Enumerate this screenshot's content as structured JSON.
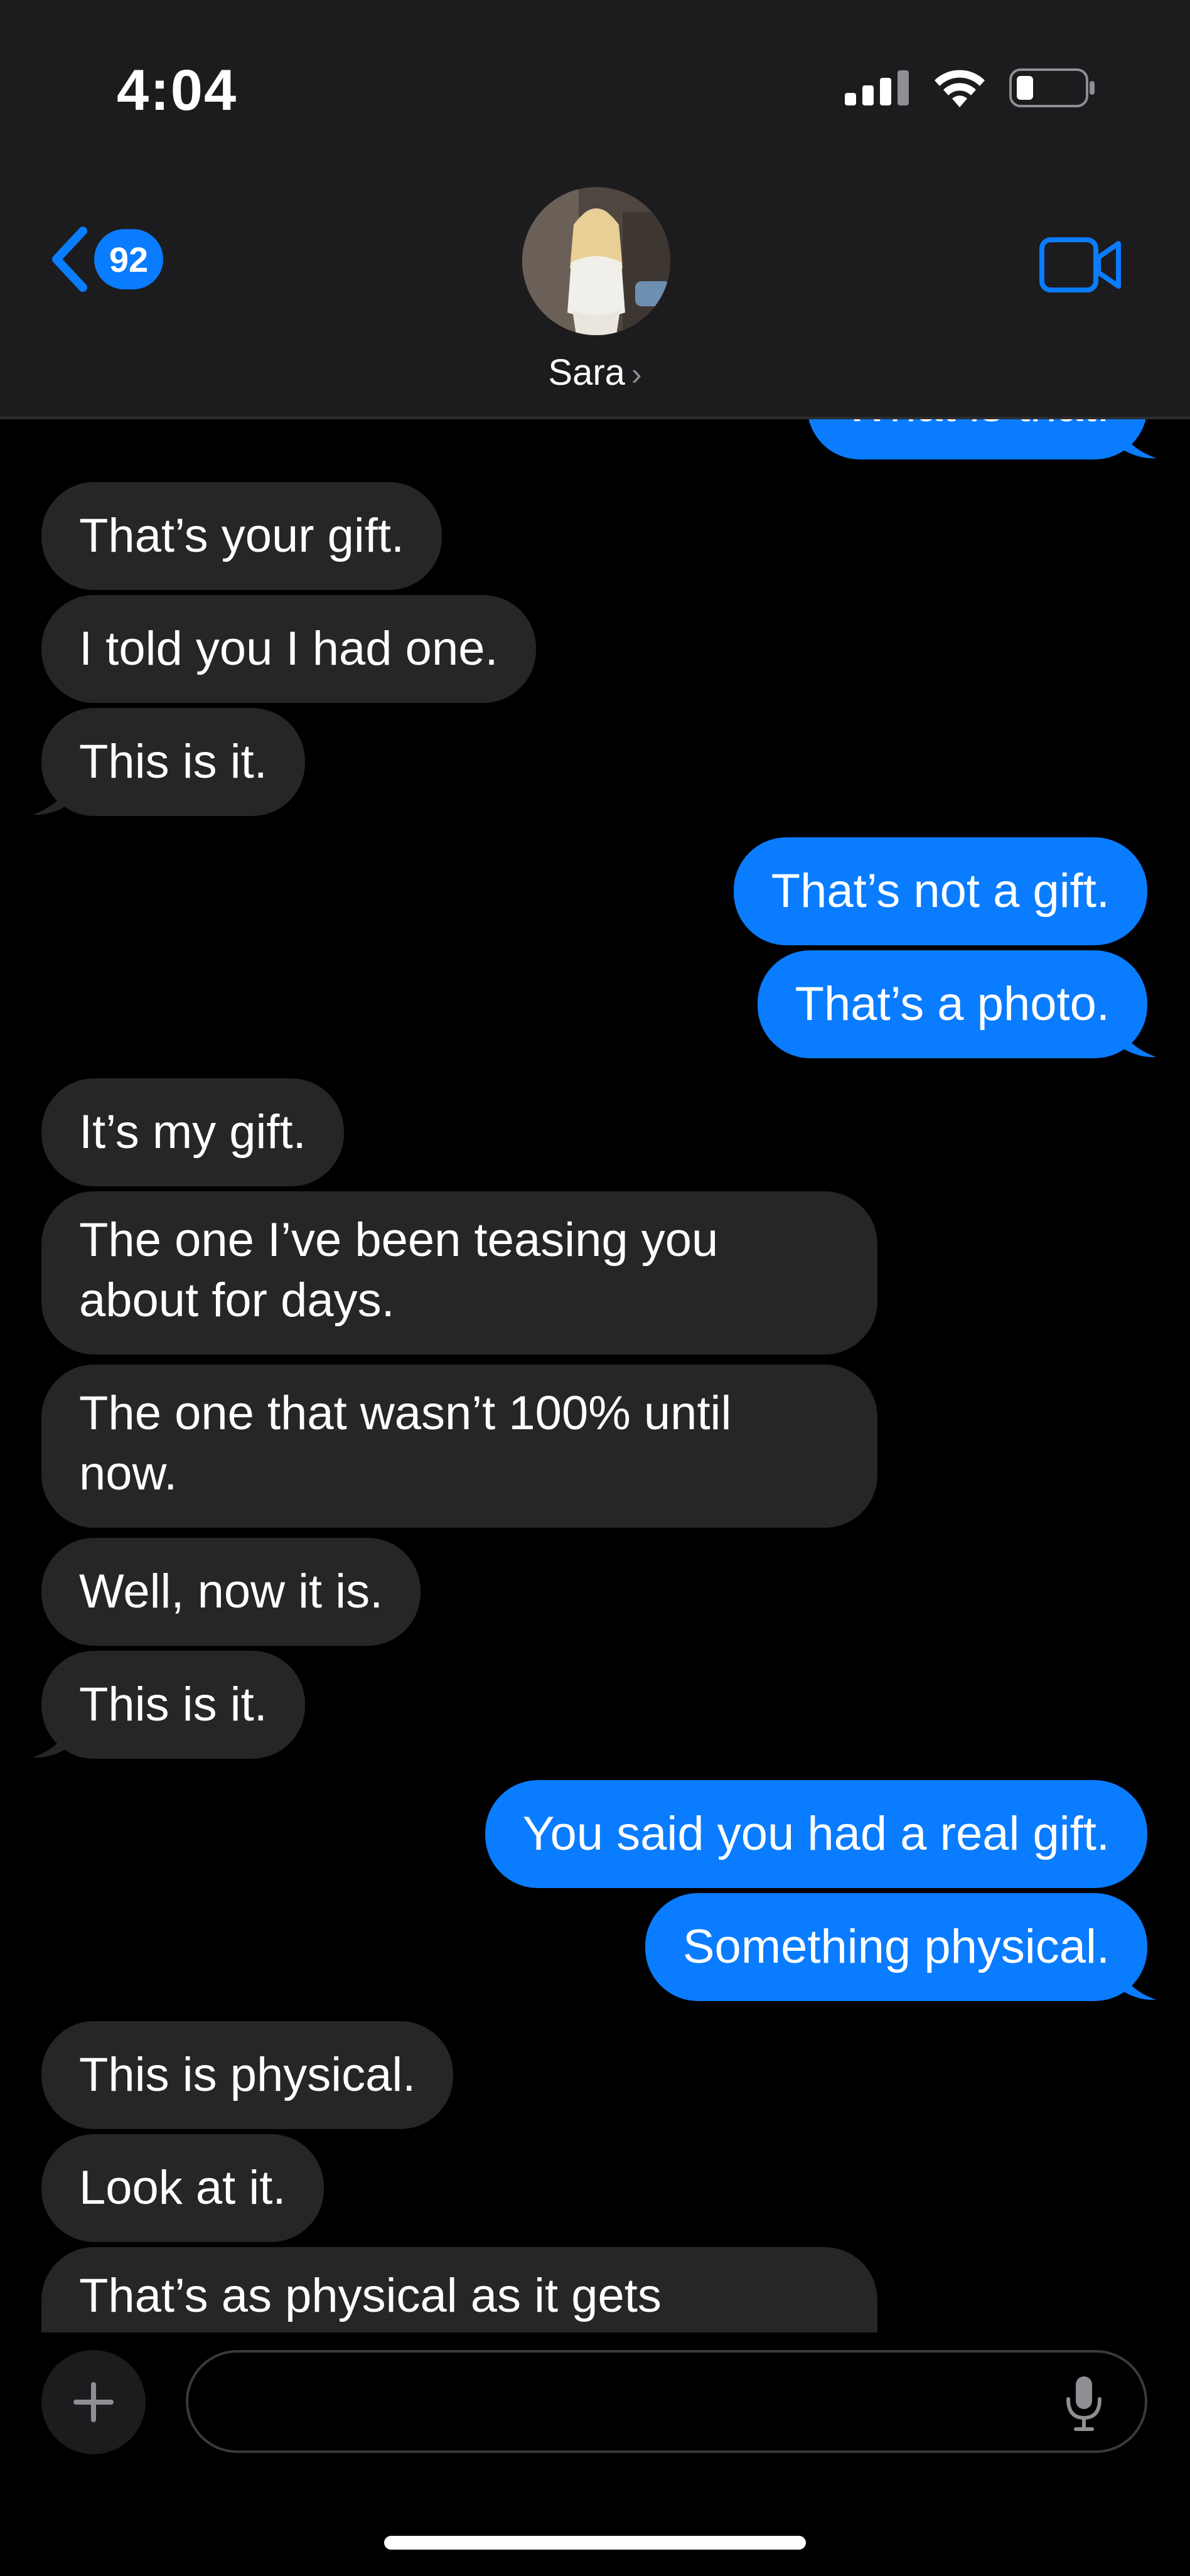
{
  "status_bar": {
    "time": "4:04"
  },
  "header": {
    "back_badge": "92",
    "contact_name": "Sara",
    "contact_chevron": "›"
  },
  "messages": [
    {
      "dir": "out",
      "text": "What is that."
    },
    {
      "dir": "in",
      "text": "That’s your gift."
    },
    {
      "dir": "in",
      "text": "I told you I had one."
    },
    {
      "dir": "in",
      "text": "This is it."
    },
    {
      "dir": "out",
      "text": "That’s not a gift."
    },
    {
      "dir": "out",
      "text": "That’s a photo."
    },
    {
      "dir": "in",
      "text": "It’s my gift."
    },
    {
      "dir": "in",
      "text": "The one I’ve been teasing you about for days."
    },
    {
      "dir": "in",
      "text": "The one that wasn’t 100% until now."
    },
    {
      "dir": "in",
      "text": "Well, now it is."
    },
    {
      "dir": "in",
      "text": "This is it."
    },
    {
      "dir": "out",
      "text": "You said you had a real gift."
    },
    {
      "dir": "out",
      "text": "Something physical."
    },
    {
      "dir": "in",
      "text": "This is physical."
    },
    {
      "dir": "in",
      "text": "Look at it."
    },
    {
      "dir": "in",
      "text": "That’s as physical as it gets"
    }
  ],
  "compose": {
    "placeholder": ""
  },
  "colors": {
    "incoming_bubble": "#262629",
    "outgoing_bubble": "#0a7cff",
    "accent": "#0a7cff",
    "background": "#000000"
  },
  "icons": [
    "back-chevron-icon",
    "video-camera-icon",
    "plus-icon",
    "microphone-icon",
    "signal-icon",
    "wifi-icon",
    "battery-icon"
  ]
}
